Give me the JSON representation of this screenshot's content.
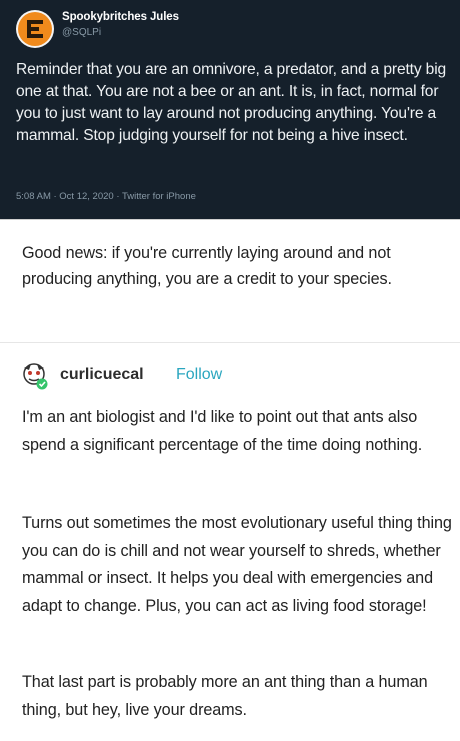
{
  "tweet": {
    "display_name": "Spookybritches Jules",
    "handle": "@SQLPi",
    "text": "Reminder that you are an omnivore, a predator, and a pretty big one at that. You are not a bee or an ant. It is, in fact, normal for you to just want to lay around not producing anything. You're a mammal. Stop judging yourself for not being a hive insect.",
    "meta": "5:08 AM · Oct 12, 2020 · Twitter for iPhone",
    "background_color": "#15202b",
    "avatar_icon": "orange-e-logo-icon"
  },
  "reply": {
    "text": "Good news: if you're currently laying around and not producing anything, you are a credit to your species."
  },
  "reblog": {
    "username": "curlicuecal",
    "follow_label": "Follow",
    "accent_color": "#2aa6bf",
    "avatar_icon": "cartoon-character-avatar-icon",
    "paragraphs": [
      "I'm an ant biologist and I'd like to point out that ants also spend a significant percentage of the time doing nothing.",
      "Turns out sometimes the most evolutionary useful thing thing you can do is chill and not wear yourself to shreds, whether mammal or insect. It helps you deal with emergencies and adapt to change. Plus, you can act as living food storage!",
      "That last part is probably more an ant thing than a human thing, but hey, live your dreams."
    ]
  }
}
